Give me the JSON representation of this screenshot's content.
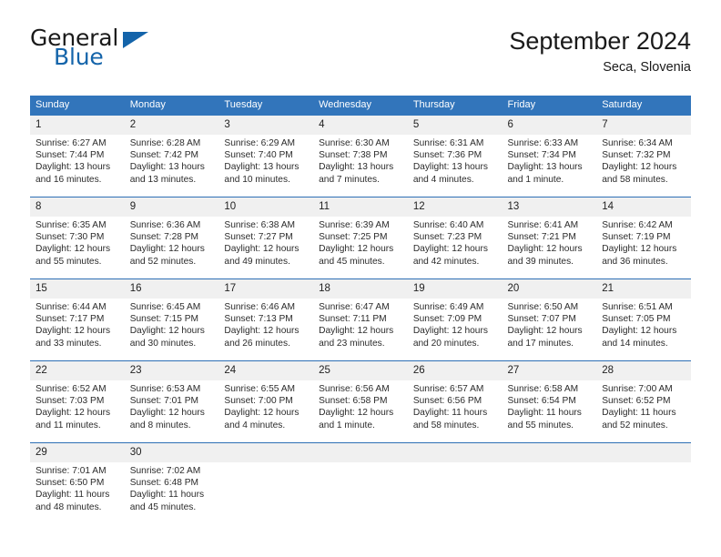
{
  "brand": {
    "name_part1": "General",
    "name_part2": "Blue",
    "triangle_color": "#1464aa"
  },
  "header": {
    "title": "September 2024",
    "subtitle": "Seca, Slovenia"
  },
  "theme": {
    "header_blue": "#3275bb",
    "row_divider_blue": "#2d6fb5",
    "daynum_band": "#f0f0f0"
  },
  "weekday_headers": [
    "Sunday",
    "Monday",
    "Tuesday",
    "Wednesday",
    "Thursday",
    "Friday",
    "Saturday"
  ],
  "weeks": [
    [
      {
        "day": "1",
        "sunrise": "Sunrise: 6:27 AM",
        "sunset": "Sunset: 7:44 PM",
        "daylight1": "Daylight: 13 hours",
        "daylight2": "and 16 minutes."
      },
      {
        "day": "2",
        "sunrise": "Sunrise: 6:28 AM",
        "sunset": "Sunset: 7:42 PM",
        "daylight1": "Daylight: 13 hours",
        "daylight2": "and 13 minutes."
      },
      {
        "day": "3",
        "sunrise": "Sunrise: 6:29 AM",
        "sunset": "Sunset: 7:40 PM",
        "daylight1": "Daylight: 13 hours",
        "daylight2": "and 10 minutes."
      },
      {
        "day": "4",
        "sunrise": "Sunrise: 6:30 AM",
        "sunset": "Sunset: 7:38 PM",
        "daylight1": "Daylight: 13 hours",
        "daylight2": "and 7 minutes."
      },
      {
        "day": "5",
        "sunrise": "Sunrise: 6:31 AM",
        "sunset": "Sunset: 7:36 PM",
        "daylight1": "Daylight: 13 hours",
        "daylight2": "and 4 minutes."
      },
      {
        "day": "6",
        "sunrise": "Sunrise: 6:33 AM",
        "sunset": "Sunset: 7:34 PM",
        "daylight1": "Daylight: 13 hours",
        "daylight2": "and 1 minute."
      },
      {
        "day": "7",
        "sunrise": "Sunrise: 6:34 AM",
        "sunset": "Sunset: 7:32 PM",
        "daylight1": "Daylight: 12 hours",
        "daylight2": "and 58 minutes."
      }
    ],
    [
      {
        "day": "8",
        "sunrise": "Sunrise: 6:35 AM",
        "sunset": "Sunset: 7:30 PM",
        "daylight1": "Daylight: 12 hours",
        "daylight2": "and 55 minutes."
      },
      {
        "day": "9",
        "sunrise": "Sunrise: 6:36 AM",
        "sunset": "Sunset: 7:28 PM",
        "daylight1": "Daylight: 12 hours",
        "daylight2": "and 52 minutes."
      },
      {
        "day": "10",
        "sunrise": "Sunrise: 6:38 AM",
        "sunset": "Sunset: 7:27 PM",
        "daylight1": "Daylight: 12 hours",
        "daylight2": "and 49 minutes."
      },
      {
        "day": "11",
        "sunrise": "Sunrise: 6:39 AM",
        "sunset": "Sunset: 7:25 PM",
        "daylight1": "Daylight: 12 hours",
        "daylight2": "and 45 minutes."
      },
      {
        "day": "12",
        "sunrise": "Sunrise: 6:40 AM",
        "sunset": "Sunset: 7:23 PM",
        "daylight1": "Daylight: 12 hours",
        "daylight2": "and 42 minutes."
      },
      {
        "day": "13",
        "sunrise": "Sunrise: 6:41 AM",
        "sunset": "Sunset: 7:21 PM",
        "daylight1": "Daylight: 12 hours",
        "daylight2": "and 39 minutes."
      },
      {
        "day": "14",
        "sunrise": "Sunrise: 6:42 AM",
        "sunset": "Sunset: 7:19 PM",
        "daylight1": "Daylight: 12 hours",
        "daylight2": "and 36 minutes."
      }
    ],
    [
      {
        "day": "15",
        "sunrise": "Sunrise: 6:44 AM",
        "sunset": "Sunset: 7:17 PM",
        "daylight1": "Daylight: 12 hours",
        "daylight2": "and 33 minutes."
      },
      {
        "day": "16",
        "sunrise": "Sunrise: 6:45 AM",
        "sunset": "Sunset: 7:15 PM",
        "daylight1": "Daylight: 12 hours",
        "daylight2": "and 30 minutes."
      },
      {
        "day": "17",
        "sunrise": "Sunrise: 6:46 AM",
        "sunset": "Sunset: 7:13 PM",
        "daylight1": "Daylight: 12 hours",
        "daylight2": "and 26 minutes."
      },
      {
        "day": "18",
        "sunrise": "Sunrise: 6:47 AM",
        "sunset": "Sunset: 7:11 PM",
        "daylight1": "Daylight: 12 hours",
        "daylight2": "and 23 minutes."
      },
      {
        "day": "19",
        "sunrise": "Sunrise: 6:49 AM",
        "sunset": "Sunset: 7:09 PM",
        "daylight1": "Daylight: 12 hours",
        "daylight2": "and 20 minutes."
      },
      {
        "day": "20",
        "sunrise": "Sunrise: 6:50 AM",
        "sunset": "Sunset: 7:07 PM",
        "daylight1": "Daylight: 12 hours",
        "daylight2": "and 17 minutes."
      },
      {
        "day": "21",
        "sunrise": "Sunrise: 6:51 AM",
        "sunset": "Sunset: 7:05 PM",
        "daylight1": "Daylight: 12 hours",
        "daylight2": "and 14 minutes."
      }
    ],
    [
      {
        "day": "22",
        "sunrise": "Sunrise: 6:52 AM",
        "sunset": "Sunset: 7:03 PM",
        "daylight1": "Daylight: 12 hours",
        "daylight2": "and 11 minutes."
      },
      {
        "day": "23",
        "sunrise": "Sunrise: 6:53 AM",
        "sunset": "Sunset: 7:01 PM",
        "daylight1": "Daylight: 12 hours",
        "daylight2": "and 8 minutes."
      },
      {
        "day": "24",
        "sunrise": "Sunrise: 6:55 AM",
        "sunset": "Sunset: 7:00 PM",
        "daylight1": "Daylight: 12 hours",
        "daylight2": "and 4 minutes."
      },
      {
        "day": "25",
        "sunrise": "Sunrise: 6:56 AM",
        "sunset": "Sunset: 6:58 PM",
        "daylight1": "Daylight: 12 hours",
        "daylight2": "and 1 minute."
      },
      {
        "day": "26",
        "sunrise": "Sunrise: 6:57 AM",
        "sunset": "Sunset: 6:56 PM",
        "daylight1": "Daylight: 11 hours",
        "daylight2": "and 58 minutes."
      },
      {
        "day": "27",
        "sunrise": "Sunrise: 6:58 AM",
        "sunset": "Sunset: 6:54 PM",
        "daylight1": "Daylight: 11 hours",
        "daylight2": "and 55 minutes."
      },
      {
        "day": "28",
        "sunrise": "Sunrise: 7:00 AM",
        "sunset": "Sunset: 6:52 PM",
        "daylight1": "Daylight: 11 hours",
        "daylight2": "and 52 minutes."
      }
    ],
    [
      {
        "day": "29",
        "sunrise": "Sunrise: 7:01 AM",
        "sunset": "Sunset: 6:50 PM",
        "daylight1": "Daylight: 11 hours",
        "daylight2": "and 48 minutes."
      },
      {
        "day": "30",
        "sunrise": "Sunrise: 7:02 AM",
        "sunset": "Sunset: 6:48 PM",
        "daylight1": "Daylight: 11 hours",
        "daylight2": "and 45 minutes."
      },
      {
        "day": "",
        "sunrise": "",
        "sunset": "",
        "daylight1": "",
        "daylight2": ""
      },
      {
        "day": "",
        "sunrise": "",
        "sunset": "",
        "daylight1": "",
        "daylight2": ""
      },
      {
        "day": "",
        "sunrise": "",
        "sunset": "",
        "daylight1": "",
        "daylight2": ""
      },
      {
        "day": "",
        "sunrise": "",
        "sunset": "",
        "daylight1": "",
        "daylight2": ""
      },
      {
        "day": "",
        "sunrise": "",
        "sunset": "",
        "daylight1": "",
        "daylight2": ""
      }
    ]
  ]
}
